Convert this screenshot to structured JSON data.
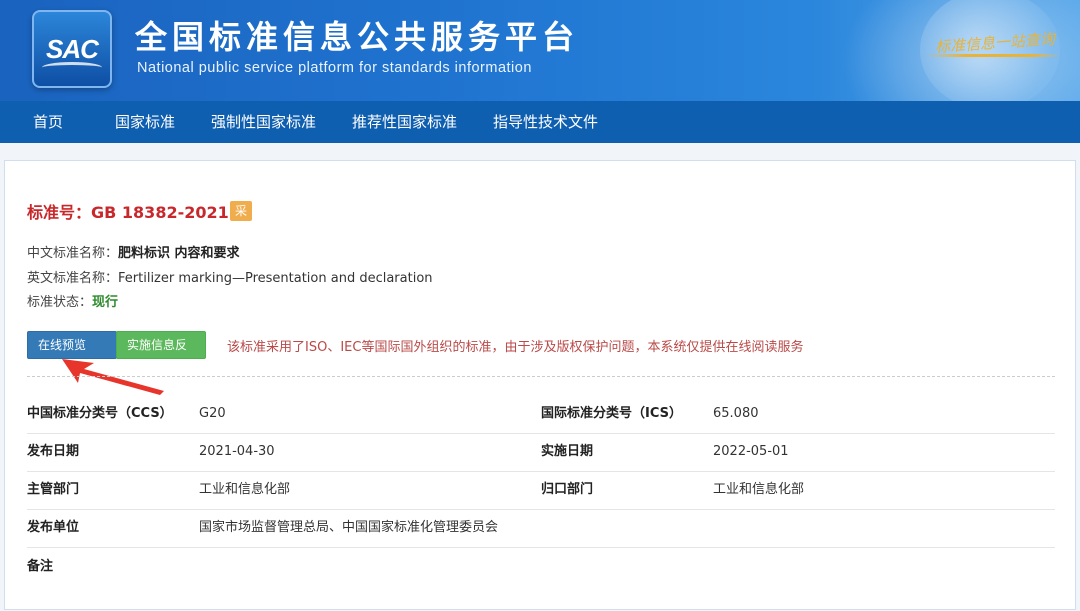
{
  "header": {
    "logo_text": "SAC",
    "title": "全国标准信息公共服务平台",
    "subtitle": "National public service platform  for standards information",
    "slogan": "标准信息一站查询"
  },
  "nav": {
    "items": [
      "首页",
      "国家标准",
      "强制性国家标准",
      "推荐性国家标准",
      "指导性技术文件"
    ]
  },
  "standard": {
    "number_label": "标准号：",
    "number": "GB 18382-2021",
    "badge": "采",
    "cn_name_label": "中文标准名称：",
    "cn_name": "肥料标识 内容和要求",
    "en_name_label": "英文标准名称：",
    "en_name": "Fertilizer marking—Presentation and declaration",
    "status_label": "标准状态：",
    "status": "现行"
  },
  "actions": {
    "preview_label": "在线预览",
    "feedback_label": "实施信息反馈",
    "notice": "该标准采用了ISO、IEC等国际国外组织的标准，由于涉及版权保护问题，本系统仅提供在线阅读服务"
  },
  "details": {
    "ccs_label": "中国标准分类号（CCS）",
    "ccs_value": "G20",
    "ics_label": "国际标准分类号（ICS）",
    "ics_value": "65.080",
    "publish_date_label": "发布日期",
    "publish_date": "2021-04-30",
    "impl_date_label": "实施日期",
    "impl_date": "2022-05-01",
    "dept_label": "主管部门",
    "dept_value": "工业和信息化部",
    "owner_label": "归口部门",
    "owner_value": "工业和信息化部",
    "issuer_label": "发布单位",
    "issuer_value": "国家市场监督管理总局、中国国家标准化管理委员会",
    "remark_label": "备注",
    "remark_value": ""
  },
  "colors": {
    "banner_blue": "#1f73cf",
    "nav_blue": "#0f5fb0",
    "standard_red": "#c8282b",
    "status_green": "#2d8a2d",
    "notice_red": "#b94a48",
    "arrow_red": "#e8352c"
  }
}
